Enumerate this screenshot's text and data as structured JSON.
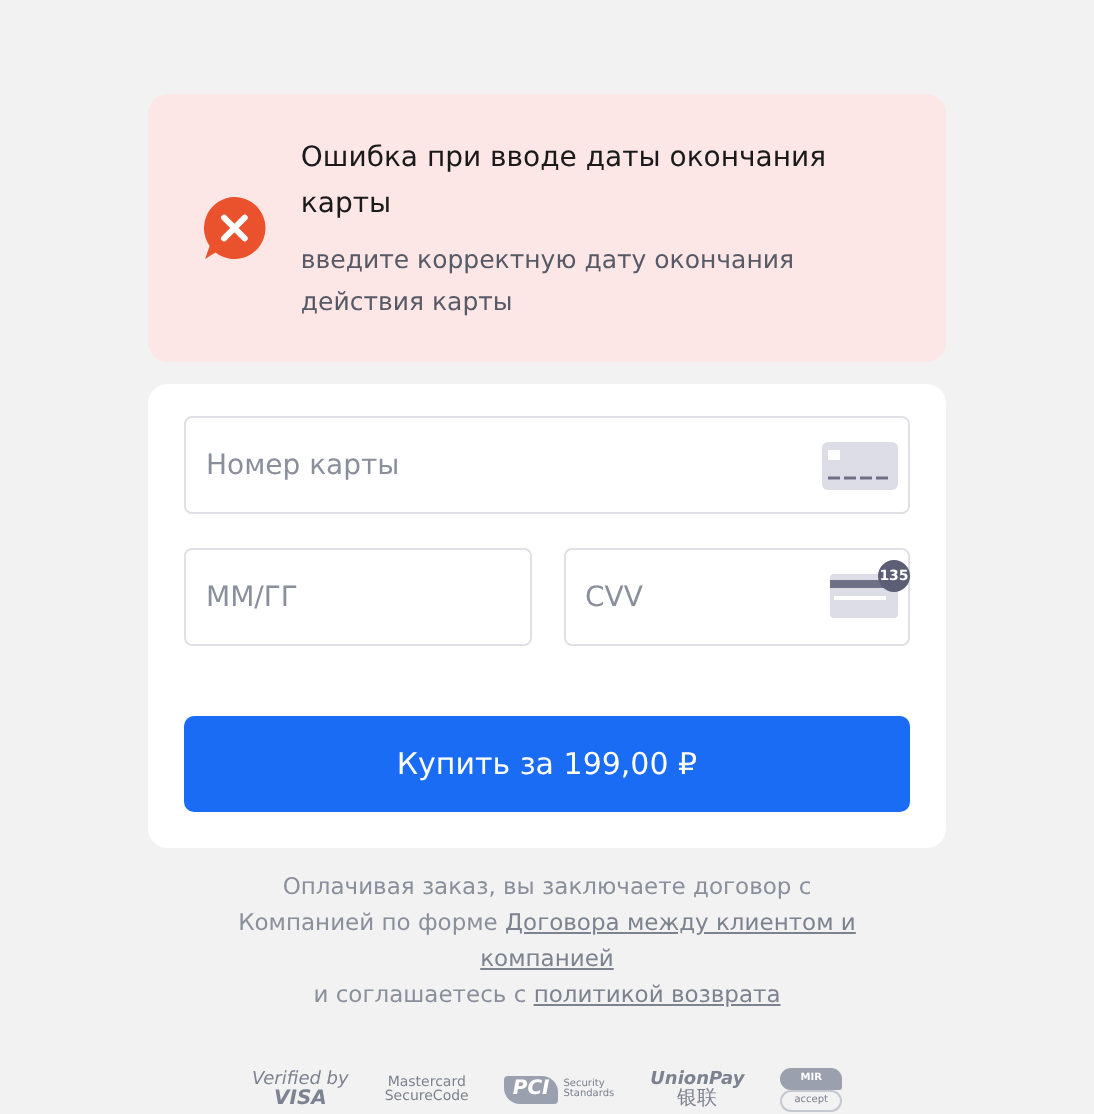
{
  "alert": {
    "title": "Ошибка при вводе даты окончания карты",
    "message": "введите корректную дату окончания действия карты"
  },
  "form": {
    "card_number": {
      "placeholder": "Номер карты"
    },
    "expiry": {
      "placeholder": "ММ/ГГ"
    },
    "cvv": {
      "placeholder": "CVV",
      "badge": "135"
    },
    "submit": "Купить за 199,00 ₽"
  },
  "legal": {
    "lines": [
      [
        {
          "text": "Оплачивая заказ, вы заключаете договор с",
          "link": false
        }
      ],
      [
        {
          "text": "Компанией по форме ",
          "link": false
        },
        {
          "text": "Договора между клиентом и",
          "link": true
        }
      ],
      [
        {
          "text": "компанией",
          "link": true
        }
      ],
      [
        {
          "text": "и соглашаетесь с ",
          "link": false
        },
        {
          "text": "политикой возврата",
          "link": true
        }
      ]
    ]
  },
  "logos": [
    {
      "kind": "visa",
      "lines": [
        "Verified by",
        "VISA"
      ]
    },
    {
      "kind": "mastercard",
      "lines": [
        "Mastercard",
        "SecureCode"
      ]
    },
    {
      "kind": "pci",
      "lines": [
        "PCI",
        "Security",
        "Standards"
      ]
    },
    {
      "kind": "unionpay",
      "lines": [
        "UnionPay",
        "银联"
      ]
    },
    {
      "kind": "mir",
      "lines": [
        "MIR",
        "accept"
      ]
    }
  ]
}
